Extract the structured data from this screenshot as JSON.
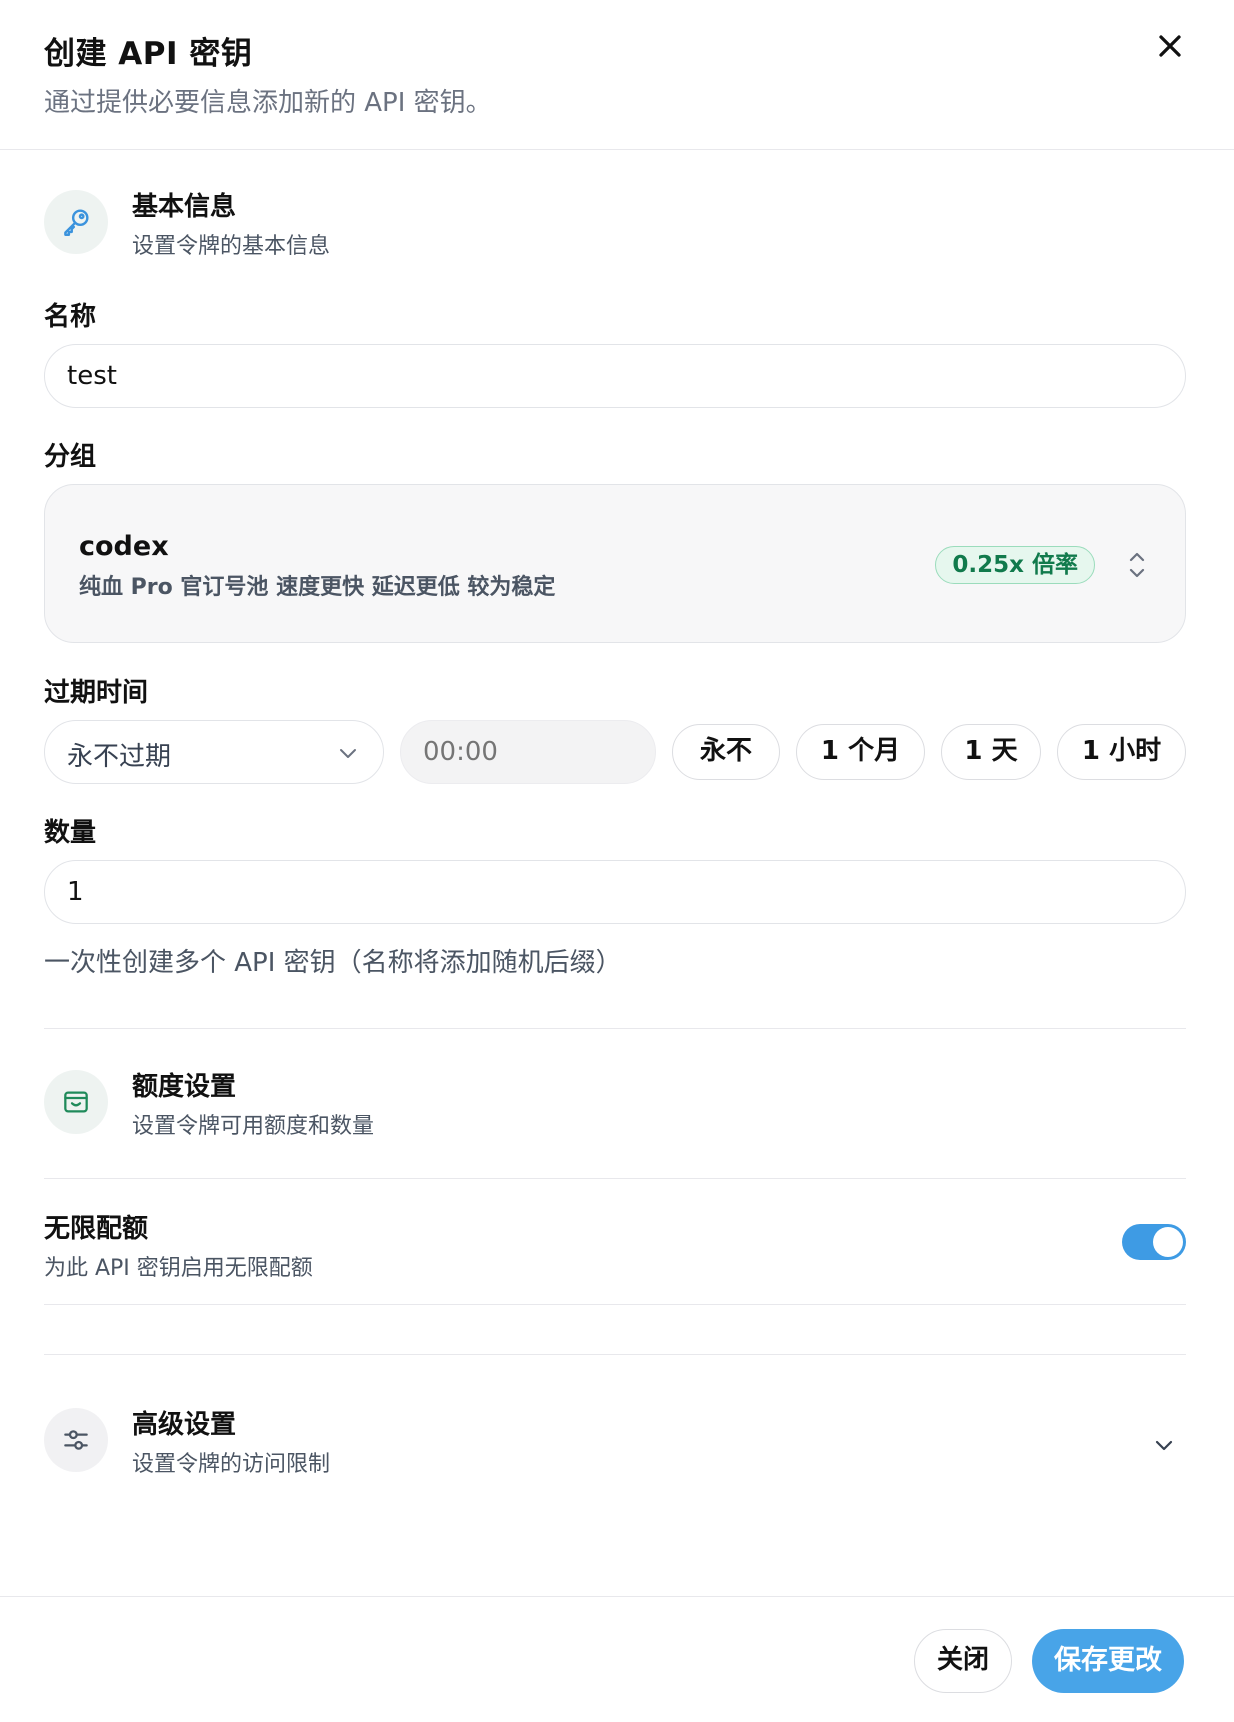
{
  "header": {
    "title": "创建 API 密钥",
    "subtitle": "通过提供必要信息添加新的 API 密钥。"
  },
  "basic": {
    "title": "基本信息",
    "desc": "设置令牌的基本信息",
    "icon": "key-icon"
  },
  "name_field": {
    "label": "名称",
    "value": "test"
  },
  "group_field": {
    "label": "分组",
    "name": "codex",
    "desc": "纯血 Pro 官订号池 速度更快 延迟更低 较为稳定",
    "ratio": "0.25x 倍率"
  },
  "expire_field": {
    "label": "过期时间",
    "selected": "永不过期",
    "time_placeholder": "00:00",
    "quick": [
      "永不",
      "1 个月",
      "1 天",
      "1 小时"
    ]
  },
  "quantity_field": {
    "label": "数量",
    "value": "1",
    "hint": "一次性创建多个 API 密钥（名称将添加随机后缀）"
  },
  "quota": {
    "title": "额度设置",
    "desc": "设置令牌可用额度和数量",
    "icon": "wallet-icon"
  },
  "unlimited": {
    "title": "无限配额",
    "desc": "为此 API 密钥启用无限配额",
    "enabled": true
  },
  "advanced": {
    "title": "高级设置",
    "desc": "设置令牌的访问限制",
    "icon": "sliders-icon"
  },
  "footer": {
    "close_label": "关闭",
    "save_label": "保存更改"
  },
  "colors": {
    "accent": "#48a4e8",
    "badge_text": "#117a4c",
    "badge_bg": "#e6f7ee"
  }
}
